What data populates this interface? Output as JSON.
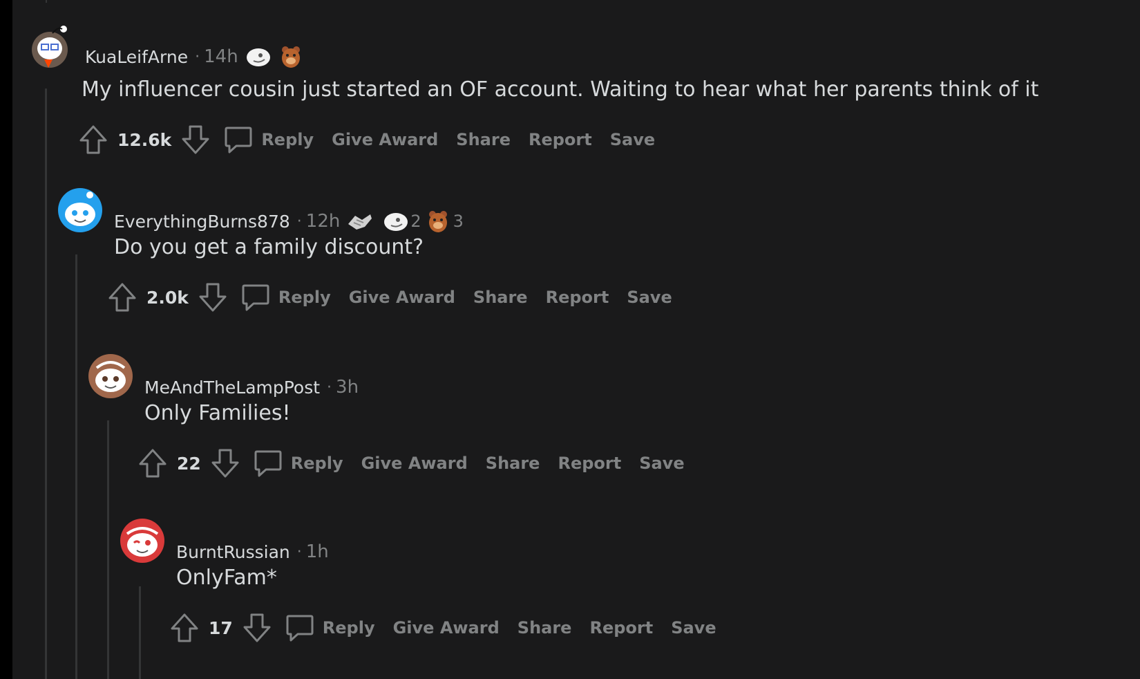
{
  "comments": [
    {
      "username": "KuaLeifArne",
      "time": "14h",
      "awards": [
        {
          "icon": "snoo-face-award-icon",
          "count": ""
        },
        {
          "icon": "bear-award-icon",
          "count": ""
        }
      ],
      "body": "My influencer cousin just started an OF account. Waiting to hear what her parents think of it",
      "score": "12.6k",
      "actions": [
        "Reply",
        "Give Award",
        "Share",
        "Report",
        "Save"
      ]
    },
    {
      "username": "EverythingBurns878",
      "time": "12h",
      "awards": [
        {
          "icon": "handshake-award-icon",
          "count": ""
        },
        {
          "icon": "snoo-face-award-icon",
          "count": "2"
        },
        {
          "icon": "bear-award-icon",
          "count": "3"
        }
      ],
      "body": "Do you get a family discount?",
      "score": "2.0k",
      "actions": [
        "Reply",
        "Give Award",
        "Share",
        "Report",
        "Save"
      ]
    },
    {
      "username": "MeAndTheLampPost",
      "time": "3h",
      "awards": [],
      "body": "Only Families!",
      "score": "22",
      "actions": [
        "Reply",
        "Give Award",
        "Share",
        "Report",
        "Save"
      ]
    },
    {
      "username": "BurntRussian",
      "time": "1h",
      "awards": [],
      "body": "OnlyFam*",
      "score": "17",
      "actions": [
        "Reply",
        "Give Award",
        "Share",
        "Report",
        "Save"
      ]
    }
  ],
  "separator": "·",
  "colors": {
    "background": "#1a1a1b",
    "text_primary": "#d7dadc",
    "text_secondary": "#818384",
    "thread_line": "#343536"
  }
}
